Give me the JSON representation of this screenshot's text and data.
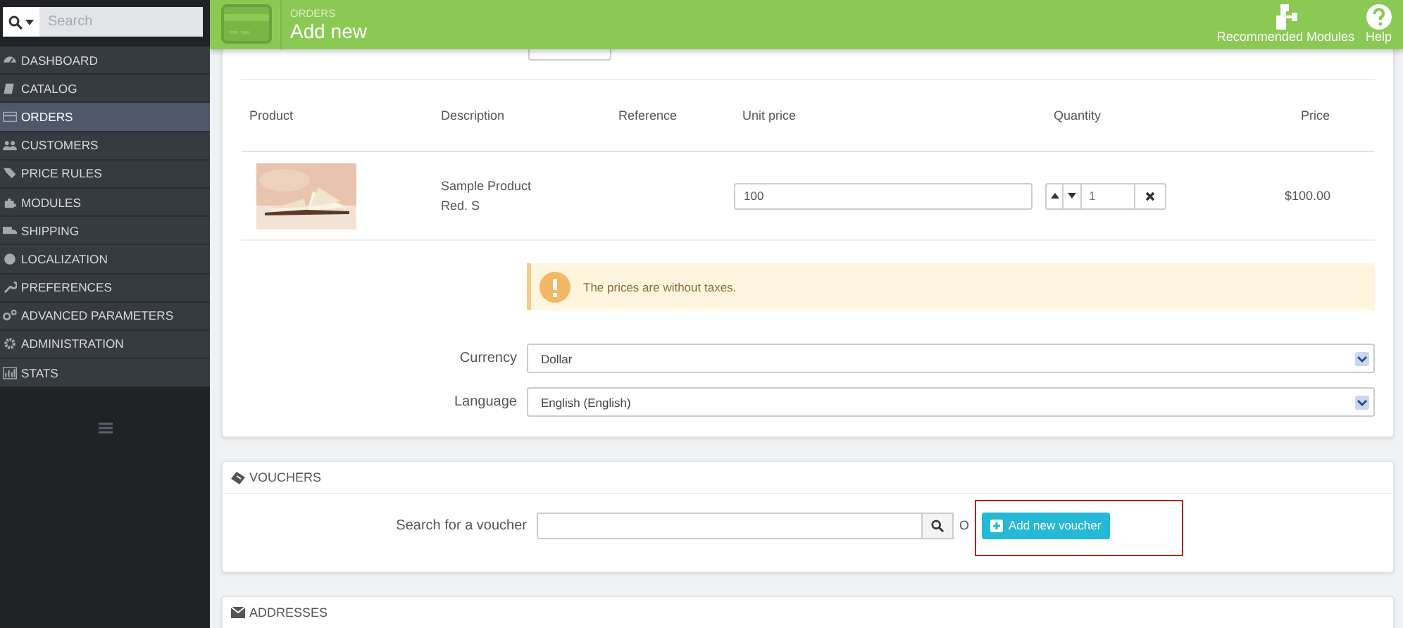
{
  "sidebar": {
    "search": {
      "placeholder": "Search"
    },
    "items": [
      {
        "label": "DASHBOARD",
        "selected": false
      },
      {
        "label": "CATALOG",
        "selected": false
      },
      {
        "label": "ORDERS",
        "selected": true
      },
      {
        "label": "CUSTOMERS",
        "selected": false
      },
      {
        "label": "PRICE RULES",
        "selected": false
      },
      {
        "label": "MODULES",
        "selected": false
      },
      {
        "label": "SHIPPING",
        "selected": false
      },
      {
        "label": "LOCALIZATION",
        "selected": false
      },
      {
        "label": "PREFERENCES",
        "selected": false
      },
      {
        "label": "ADVANCED PARAMETERS",
        "selected": false
      },
      {
        "label": "ADMINISTRATION",
        "selected": false
      },
      {
        "label": "STATS",
        "selected": false
      }
    ]
  },
  "header": {
    "breadcrumb": "ORDERS",
    "title": "Add new",
    "actions": [
      {
        "label": "Recommended Modules",
        "kind": "modules"
      },
      {
        "label": "Help",
        "kind": "help"
      }
    ]
  },
  "cart": {
    "columns": [
      "Product",
      "Description",
      "Reference",
      "Unit price",
      "Quantity",
      "Price"
    ],
    "rows": [
      {
        "description": [
          "Sample Product",
          "Red. S"
        ],
        "unit_price": "100",
        "quantity": "1",
        "price": "$100.00"
      }
    ]
  },
  "alert": "The prices are without taxes.",
  "fields": [
    {
      "label": "Currency",
      "value": "Dollar"
    },
    {
      "label": "Language",
      "value": "English (English)"
    }
  ],
  "vouchers": {
    "title": "VOUCHERS",
    "search_label": "Search for a voucher",
    "or_text": "O",
    "button": "Add new voucher"
  },
  "addresses": {
    "title": "ADDRESSES"
  }
}
